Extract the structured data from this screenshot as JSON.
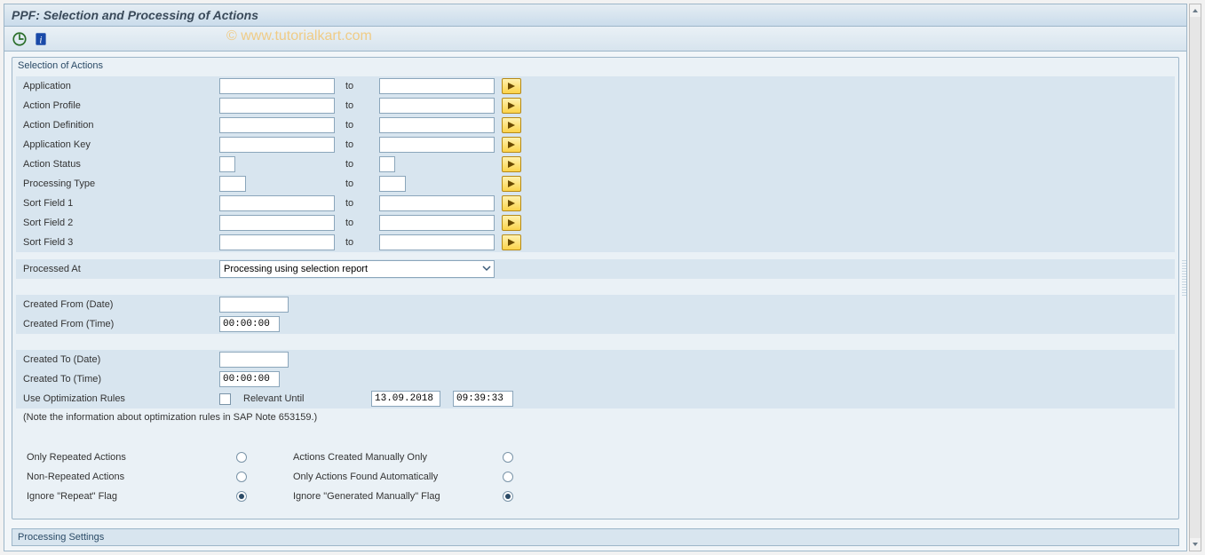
{
  "title": "PPF: Selection and Processing of Actions",
  "watermark": "© www.tutorialkart.com",
  "group1_title": "Selection of Actions",
  "group2_title": "Processing Settings",
  "to_label": "to",
  "range_rows": [
    {
      "label": "Application",
      "size": "lg"
    },
    {
      "label": "Action Profile",
      "size": "lg"
    },
    {
      "label": "Action Definition",
      "size": "lg"
    },
    {
      "label": "Application Key",
      "size": "lg"
    },
    {
      "label": "Action Status",
      "size": "xs"
    },
    {
      "label": "Processing Type",
      "size": "sm"
    },
    {
      "label": "Sort Field 1",
      "size": "lg"
    },
    {
      "label": "Sort Field 2",
      "size": "lg"
    },
    {
      "label": "Sort Field 3",
      "size": "lg"
    }
  ],
  "processed_at": {
    "label": "Processed At",
    "value": "Processing using selection report"
  },
  "created_from_date": {
    "label": "Created From (Date)",
    "value": ""
  },
  "created_from_time": {
    "label": "Created From (Time)",
    "value": "00:00:00"
  },
  "created_to_date": {
    "label": "Created To (Date)",
    "value": ""
  },
  "created_to_time": {
    "label": "Created To (Time)",
    "value": "00:00:00"
  },
  "use_opt": {
    "label": "Use Optimization Rules",
    "relevant_label": "Relevant Until",
    "date": "13.09.2018",
    "time": "09:39:33"
  },
  "note": "(Note the information about optimization rules in SAP Note 653159.)",
  "radio_left": [
    {
      "label": "Only Repeated Actions",
      "selected": false
    },
    {
      "label": "Non-Repeated Actions",
      "selected": false
    },
    {
      "label": "Ignore \"Repeat\" Flag",
      "selected": true
    }
  ],
  "radio_right": [
    {
      "label": "Actions Created Manually Only",
      "selected": false
    },
    {
      "label": "Only Actions Found Automatically",
      "selected": false
    },
    {
      "label": "Ignore \"Generated Manually\" Flag",
      "selected": true
    }
  ]
}
